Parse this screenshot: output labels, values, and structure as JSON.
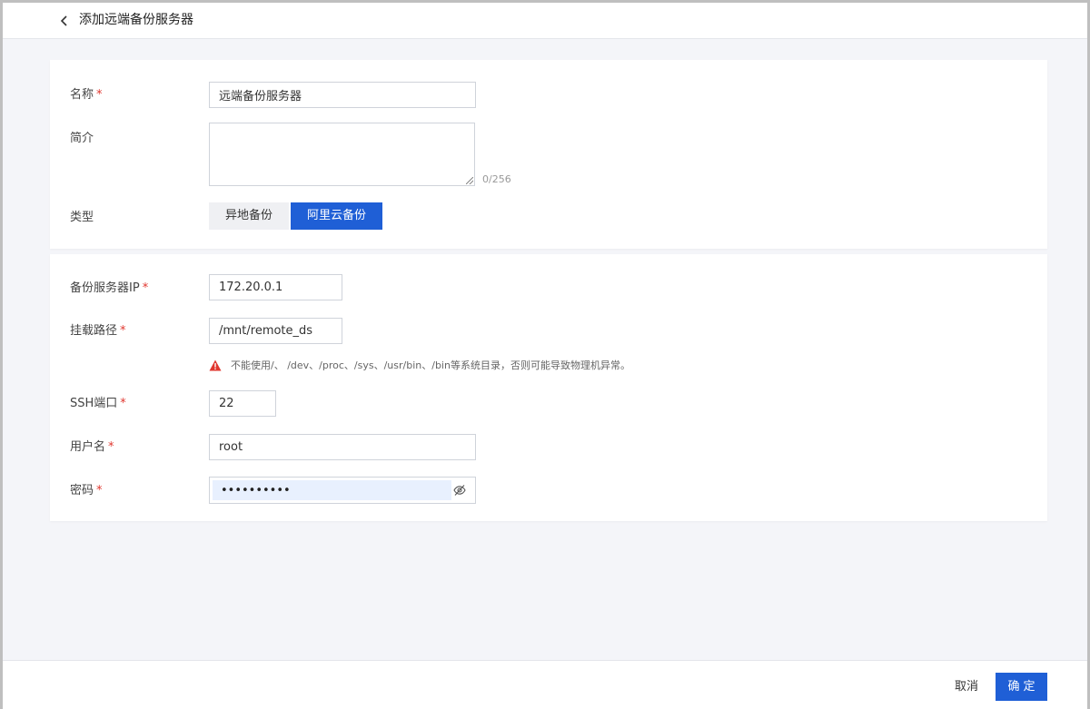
{
  "header": {
    "title": "添加远端备份服务器",
    "back_icon": "chevron-left-icon"
  },
  "basic": {
    "name_label": "名称",
    "name_value": "远端备份服务器",
    "desc_label": "简介",
    "desc_value": "",
    "desc_counter": "0/256",
    "type_label": "类型",
    "type_options": [
      "异地备份",
      "阿里云备份"
    ],
    "type_selected": "阿里云备份"
  },
  "server": {
    "ip_label": "备份服务器IP",
    "ip_value": "172.20.0.1",
    "mount_label": "挂载路径",
    "mount_value": "/mnt/remote_ds",
    "mount_warning": "不能使用/、 /dev、/proc、/sys、/usr/bin、/bin等系统目录，否则可能导致物理机异常。",
    "ssh_label": "SSH端口",
    "ssh_value": "22",
    "user_label": "用户名",
    "user_value": "root",
    "pwd_label": "密码",
    "pwd_value": "••••••••••"
  },
  "required_mark": "*",
  "footer": {
    "cancel_label": "取消",
    "ok_label": "确定"
  },
  "colors": {
    "primary": "#1f5fd6",
    "required": "#e0372f",
    "warning": "#e0372f",
    "autofill": "#e8f0fe"
  }
}
